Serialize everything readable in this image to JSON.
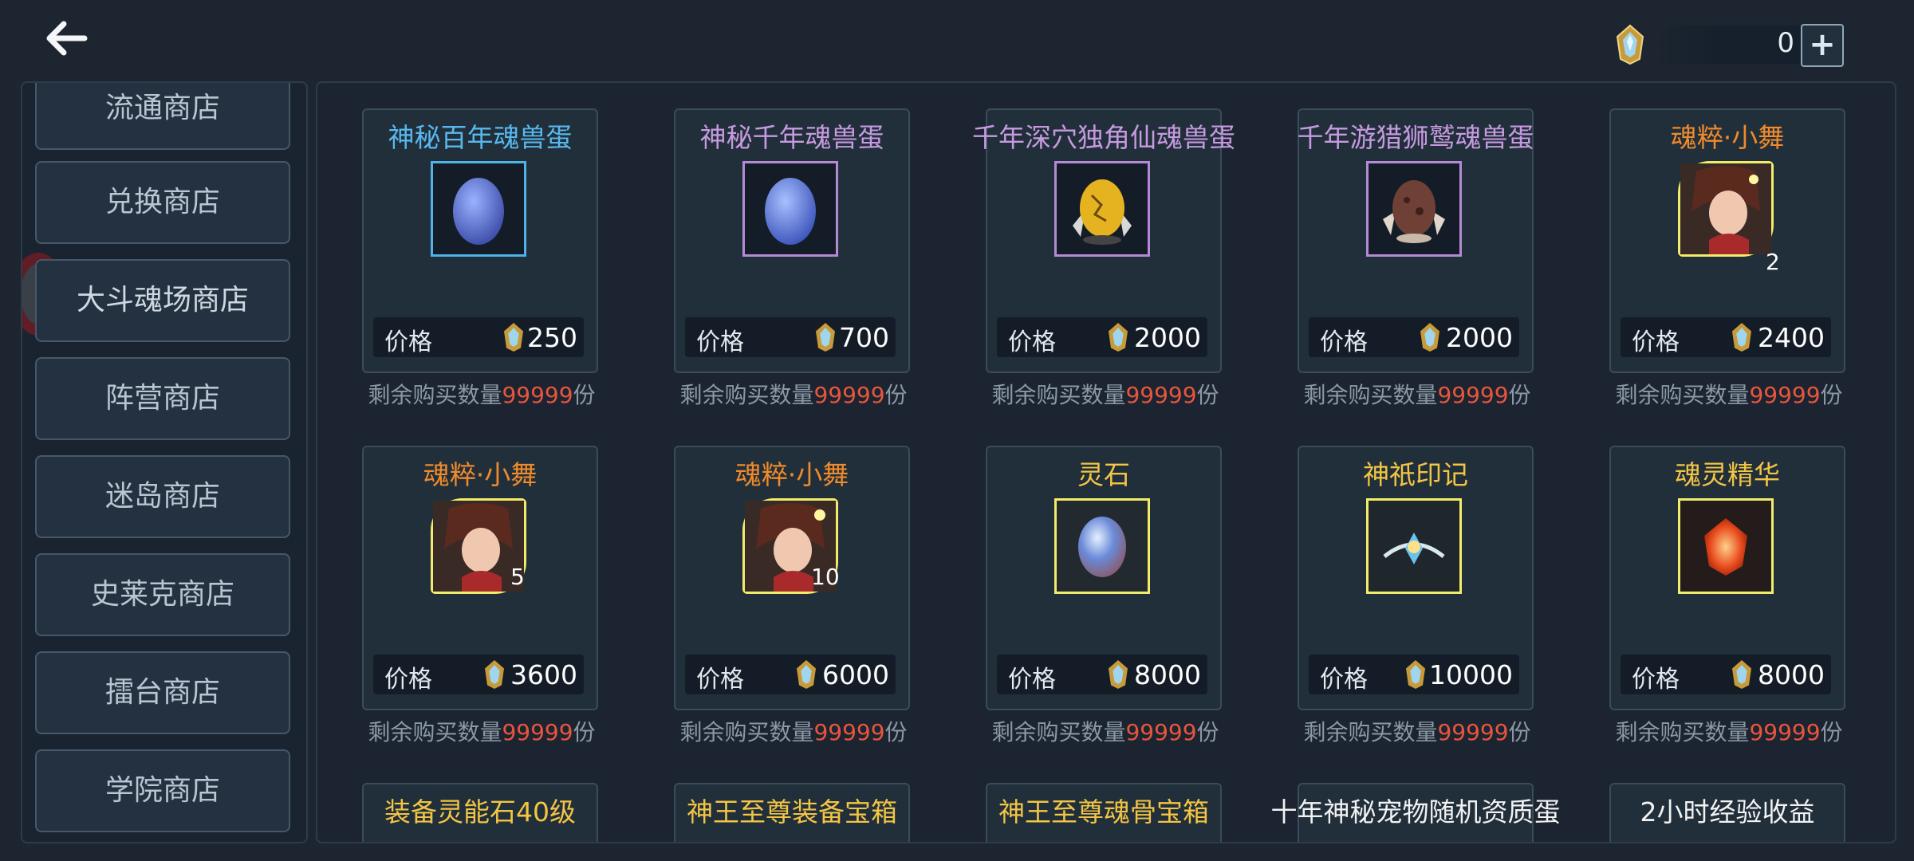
{
  "header": {
    "back_icon": "back-arrow-icon",
    "currency": {
      "icon": "soul-crystal-icon",
      "value": "0",
      "add_label": "+"
    }
  },
  "sidebar": {
    "items": [
      {
        "label": "流通商店"
      },
      {
        "label": "兑换商店"
      },
      {
        "label": "大斗魂场商店"
      },
      {
        "label": "阵营商店"
      },
      {
        "label": "迷岛商店"
      },
      {
        "label": "史莱克商店"
      },
      {
        "label": "擂台商店"
      },
      {
        "label": "学院商店"
      }
    ]
  },
  "shop": {
    "price_label": "价格",
    "remain_prefix": "剩余购买数量",
    "remain_suffix": "份",
    "items": [
      {
        "name": "神秘百年魂兽蛋",
        "name_color": "blue",
        "frame": "blue",
        "icon": "blue-egg-icon",
        "price": "250",
        "remain": "99999"
      },
      {
        "name": "神秘千年魂兽蛋",
        "name_color": "lilac",
        "frame": "purple",
        "icon": "blue-egg-icon",
        "price": "700",
        "remain": "99999"
      },
      {
        "name": "千年深穴独角仙魂兽蛋",
        "name_color": "lilac",
        "frame": "purple",
        "icon": "golden-beetle-egg-icon",
        "price": "2000",
        "remain": "99999"
      },
      {
        "name": "千年游猎狮鹫魂兽蛋",
        "name_color": "lilac",
        "frame": "purple",
        "icon": "brown-griffin-egg-icon",
        "price": "2000",
        "remain": "99999"
      },
      {
        "name": "魂粹·小舞",
        "name_color": "orange",
        "frame": "gold",
        "icon": "xiaowu-portrait-icon",
        "badge": "2",
        "price": "2400",
        "remain": "99999"
      },
      {
        "name": "魂粹·小舞",
        "name_color": "orange",
        "frame": "gold",
        "icon": "xiaowu-portrait-icon",
        "badge": "5",
        "price": "3600",
        "remain": "99999"
      },
      {
        "name": "魂粹·小舞",
        "name_color": "orange",
        "frame": "gold",
        "icon": "xiaowu-portrait-icon",
        "badge": "10",
        "price": "6000",
        "remain": "99999"
      },
      {
        "name": "灵石",
        "name_color": "yellow",
        "frame": "gold",
        "icon": "spirit-stone-icon",
        "price": "8000",
        "remain": "99999"
      },
      {
        "name": "神祇印记",
        "name_color": "yellow",
        "frame": "gold",
        "icon": "divine-mark-icon",
        "price": "10000",
        "remain": "99999"
      },
      {
        "name": "魂灵精华",
        "name_color": "yellow",
        "frame": "gold",
        "icon": "soul-essence-icon",
        "price": "8000",
        "remain": "99999"
      }
    ],
    "partial_items": [
      {
        "name": "装备灵能石40级",
        "name_color": "yellow"
      },
      {
        "name": "神王至尊装备宝箱",
        "name_color": "yellow"
      },
      {
        "name": "神王至尊魂骨宝箱",
        "name_color": "yellow"
      },
      {
        "name": "十年神秘宠物随机资质蛋",
        "name_color": "white"
      },
      {
        "name": "2小时经验收益",
        "name_color": "white"
      }
    ]
  }
}
